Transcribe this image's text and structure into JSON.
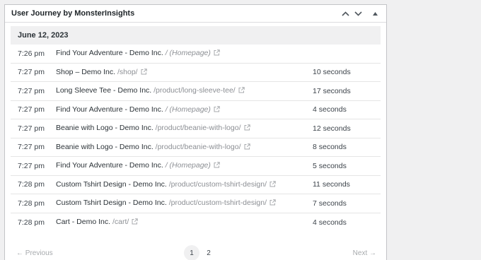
{
  "panel": {
    "title": "User Journey by MonsterInsights",
    "icons": [
      "chevron-up-icon",
      "chevron-down-icon",
      "collapse-triangle-icon"
    ]
  },
  "date": "June 12, 2023",
  "rows": [
    {
      "time": "7:26 pm",
      "title": "Find Your Adventure - Demo Inc.",
      "path": "/ (Homepage)",
      "duration": ""
    },
    {
      "time": "7:27 pm",
      "title": "Shop – Demo Inc.",
      "path": "/shop/",
      "duration": "10 seconds"
    },
    {
      "time": "7:27 pm",
      "title": "Long Sleeve Tee - Demo Inc.",
      "path": "/product/long-sleeve-tee/",
      "duration": "17 seconds"
    },
    {
      "time": "7:27 pm",
      "title": "Find Your Adventure - Demo Inc.",
      "path": "/ (Homepage)",
      "duration": "4 seconds"
    },
    {
      "time": "7:27 pm",
      "title": "Beanie with Logo - Demo Inc.",
      "path": "/product/beanie-with-logo/",
      "duration": "12 seconds"
    },
    {
      "time": "7:27 pm",
      "title": "Beanie with Logo - Demo Inc.",
      "path": "/product/beanie-with-logo/",
      "duration": "8 seconds"
    },
    {
      "time": "7:27 pm",
      "title": "Find Your Adventure - Demo Inc.",
      "path": "/ (Homepage)",
      "duration": "5 seconds"
    },
    {
      "time": "7:28 pm",
      "title": "Custom Tshirt Design - Demo Inc.",
      "path": "/product/custom-tshirt-design/",
      "duration": "11 seconds"
    },
    {
      "time": "7:28 pm",
      "title": "Custom Tshirt Design - Demo Inc.",
      "path": "/product/custom-tshirt-design/",
      "duration": "7 seconds"
    },
    {
      "time": "7:28 pm",
      "title": "Cart - Demo Inc.",
      "path": "/cart/",
      "duration": "4 seconds"
    }
  ],
  "pagination": {
    "prev": "← Previous",
    "next": "Next →",
    "pages": [
      "1",
      "2"
    ],
    "current": "1"
  }
}
